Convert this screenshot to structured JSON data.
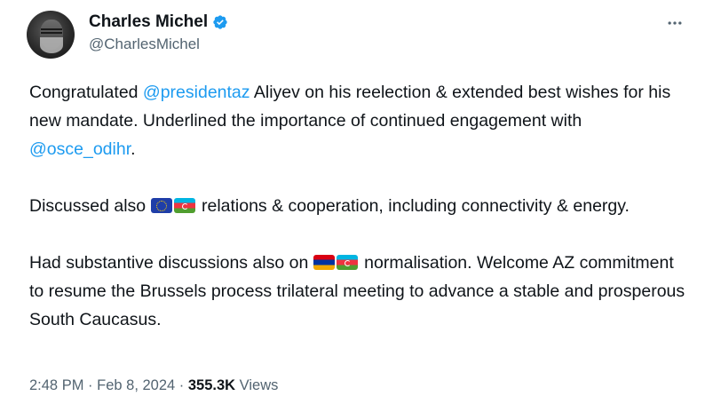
{
  "author": {
    "display_name": "Charles Michel",
    "handle": "@CharlesMichel",
    "verified": true,
    "verified_color": "#1d9bf0"
  },
  "menu": {
    "icon": "more-horizontal-icon"
  },
  "tweet": {
    "p1_a": "Congratulated ",
    "p1_mention": "@presidentaz",
    "p1_b": " Aliyev on his reelection & extended best wishes for his new mandate. Underlined the importance of continued engagement with ",
    "p1_mention2": "@osce_odihr",
    "p1_c": ".",
    "p2_a": "Discussed also ",
    "p2_flags": [
      "flag-eu-icon",
      "flag-azerbaijan-icon"
    ],
    "p2_b": " relations & cooperation, including connectivity & energy.",
    "p3_a": "Had substantive discussions also on ",
    "p3_flags": [
      "flag-armenia-icon",
      "flag-azerbaijan-icon"
    ],
    "p3_b": " normalisation. Welcome AZ commitment to resume the Brussels process trilateral meeting to advance a stable and prosperous South Caucasus."
  },
  "meta": {
    "time": "2:48 PM",
    "sep1": " · ",
    "date": "Feb 8, 2024",
    "sep2": " · ",
    "views_count": "355.3K",
    "views_label": " Views"
  },
  "colors": {
    "link": "#1d9bf0",
    "secondary_text": "#536471",
    "primary_text": "#0f1419"
  }
}
